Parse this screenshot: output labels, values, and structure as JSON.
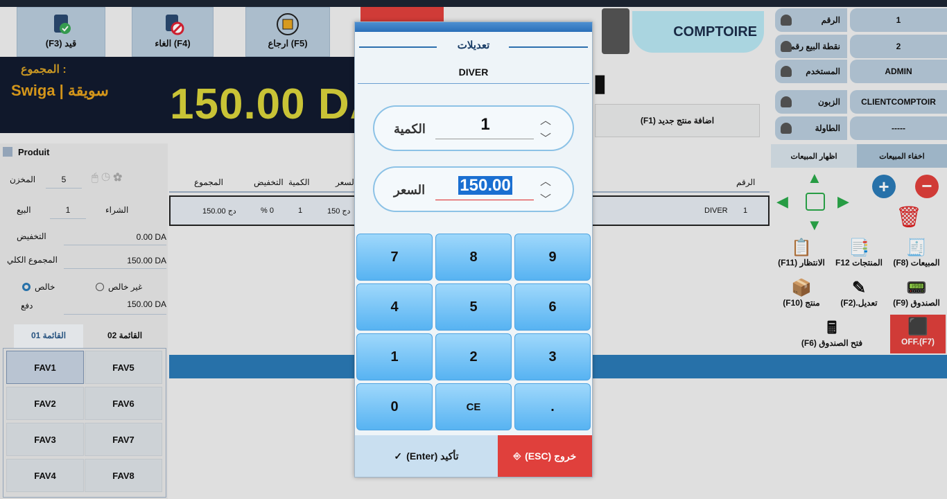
{
  "toolbar": {
    "wait_label": "(F3) قيد",
    "cancel_label": "الغاء (F4)",
    "return_label": "ارجاع (F5)",
    "comptoir": "COMPTOIRE"
  },
  "total": {
    "label": "المجموع :",
    "value": "150.00 DA",
    "brand": "Swiga | سويقة"
  },
  "info": [
    {
      "label": "الرقم",
      "value": "1"
    },
    {
      "label": "نقطة البيع رقم",
      "value": "2"
    },
    {
      "label": "المستخدم",
      "value": "ADMIN"
    },
    {
      "label": "الزبون",
      "value": "CLIENTCOMPTOIR"
    },
    {
      "label": "الطاولة",
      "value": "-----"
    }
  ],
  "add_product": "(F1) اضافة منتج جديد",
  "sales_tabs": {
    "hide": "اخفاء المبيعات",
    "show": "اظهار المبيعات"
  },
  "fkeys": {
    "f8": "(F8) المبيعات",
    "f12": "F12 المنتجات",
    "f11": "(F11) الانتظار",
    "f9": "(F9) الصندوق",
    "f2": "(F2).تعديل",
    "f10": "(F10) منتج",
    "f6": "(F6) فتح الصندوق",
    "f7": "OFF.(F7)"
  },
  "left": {
    "produit": "Produit",
    "stock_label": "المخزن",
    "stock_value": "5",
    "buy_label": "الشراء",
    "buy_value": "1",
    "sell_label": "البيع",
    "discount_label": "التخفيض",
    "discount_value": "0.00 DA",
    "grand_label": "المجموع الكلي",
    "grand_value": "150.00 DA",
    "paid_label": "خالص",
    "unpaid_label": "غير خالص",
    "pay_label": "دفع",
    "pay_value": "150.00 DA",
    "list1": "القائمة 01",
    "list2": "القائمة 02",
    "favs": [
      "FAV1",
      "FAV5",
      "FAV2",
      "FAV6",
      "FAV3",
      "FAV7",
      "FAV4",
      "FAV8"
    ]
  },
  "table": {
    "headers": {
      "num": "الرقم",
      "price": "السعر",
      "qty": "الكمية",
      "disc": "التخفيض",
      "total": "المجموع"
    },
    "row": {
      "num": "1",
      "name": "DIVER",
      "price": "150 دج",
      "qty": "1",
      "disc": "% 0",
      "total": "150.00 دج"
    }
  },
  "modal": {
    "title": "تعديلات",
    "product": "DIVER",
    "qty_label": "الكمية",
    "qty_value": "1",
    "price_label": "السعر",
    "price_value": "150.00",
    "keys": [
      "7",
      "8",
      "9",
      "4",
      "5",
      "6",
      "1",
      "2",
      "3",
      "0",
      "CE",
      "."
    ],
    "confirm": "(Enter) تأكيد",
    "exit": "(ESC) خروج"
  },
  "colors": {
    "accent": "#2a7ab6",
    "total_text": "#d9d23b",
    "danger": "#e0403c"
  }
}
